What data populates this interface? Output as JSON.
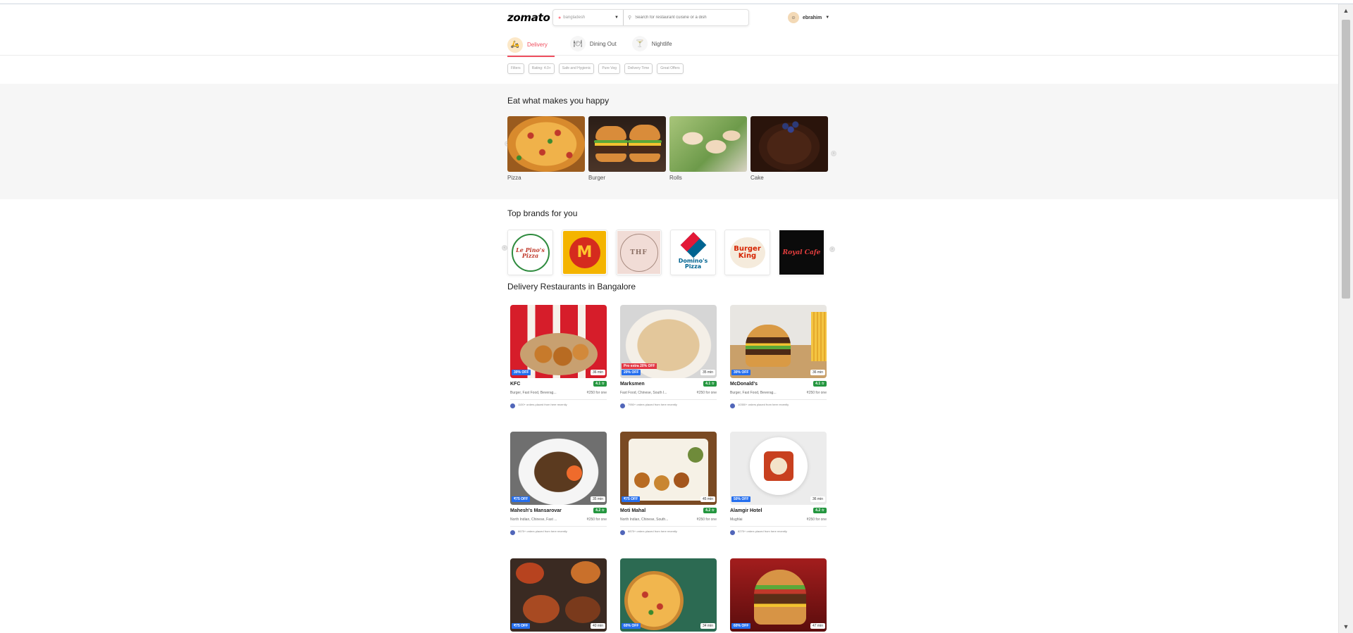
{
  "header": {
    "logo": "zomato",
    "location": "bangladesh",
    "search_placeholder": "Search for restaurant cuisine or a dish",
    "user_name": "ebrahim"
  },
  "tabs": [
    {
      "label": "Delivery",
      "active": true,
      "icon": "delivery-icon"
    },
    {
      "label": "Dining Out",
      "active": false,
      "icon": "dining-icon"
    },
    {
      "label": "Nightlife",
      "active": false,
      "icon": "nightlife-icon"
    }
  ],
  "filters": [
    "Filters",
    "Rating: 4.0+",
    "Safe and Hygienic",
    "Pure Veg",
    "Delivery Time",
    "Great Offers"
  ],
  "eat": {
    "title": "Eat what makes you happy",
    "items": [
      "Pizza",
      "Burger",
      "Rolls",
      "Cake"
    ]
  },
  "brands": {
    "title": "Top brands for you",
    "items": [
      "Le Pino's Pizza",
      "McDonald's",
      "THF",
      "Domino's Pizza",
      "Burger King",
      "Royal Cafe"
    ]
  },
  "restaurants": {
    "title": "Delivery Restaurants in Bangalore",
    "items": [
      {
        "name": "KFC",
        "rating": "4.1 ☆",
        "offer": "30% OFF",
        "time": "36 min",
        "cuisine": "Burger, Fast Food, Beverag...",
        "price": "₹250 for one",
        "orders": "1100+ orders placed from here recently"
      },
      {
        "name": "Marksmen",
        "rating": "4.1 ☆",
        "offer": "20% OFF",
        "promo": "Pro extra 20% OFF",
        "time": "35 min",
        "cuisine": "Fast Food, Chinese, South I...",
        "price": "₹250 for one",
        "orders": "7950+ orders placed from here recently"
      },
      {
        "name": "McDonald's",
        "rating": "4.1 ☆",
        "offer": "30% OFF",
        "time": "36 min",
        "cuisine": "Burger, Fast Food, Beverag...",
        "price": "₹250 for one",
        "orders": "10350+ orders placed from here recently"
      },
      {
        "name": "Mahesh's Mansarovar",
        "rating": "4.2 ☆",
        "offer": "₹75 OFF",
        "time": "35 min",
        "cuisine": "North Indian, Chinese, Fast ...",
        "price": "₹250 for one",
        "orders": "8675+ orders placed from here recently"
      },
      {
        "name": "Moti Mahal",
        "rating": "4.2 ☆",
        "offer": "₹75 OFF",
        "time": "45 min",
        "cuisine": "North Indian, Chinese, South...",
        "price": "₹250 for one",
        "orders": "6875+ orders placed from here recently"
      },
      {
        "name": "Alamgir Hotel",
        "rating": "4.2 ☆",
        "offer": "50% OFF",
        "time": "36 min",
        "cuisine": "Mughlai",
        "price": "₹250 for one",
        "orders": "8275+ orders placed from here recently"
      },
      {
        "name": "",
        "rating": "",
        "offer": "₹75 OFF",
        "time": "40 min",
        "cuisine": "",
        "price": "",
        "orders": ""
      },
      {
        "name": "",
        "rating": "",
        "offer": "60% OFF",
        "time": "34 min",
        "cuisine": "",
        "price": "",
        "orders": ""
      },
      {
        "name": "",
        "rating": "",
        "offer": "60% OFF",
        "time": "47 min",
        "cuisine": "",
        "price": "",
        "orders": ""
      }
    ]
  },
  "colors": {
    "accent": "#ef4f5f",
    "rating": "#24963f",
    "offer": "#256fef"
  }
}
